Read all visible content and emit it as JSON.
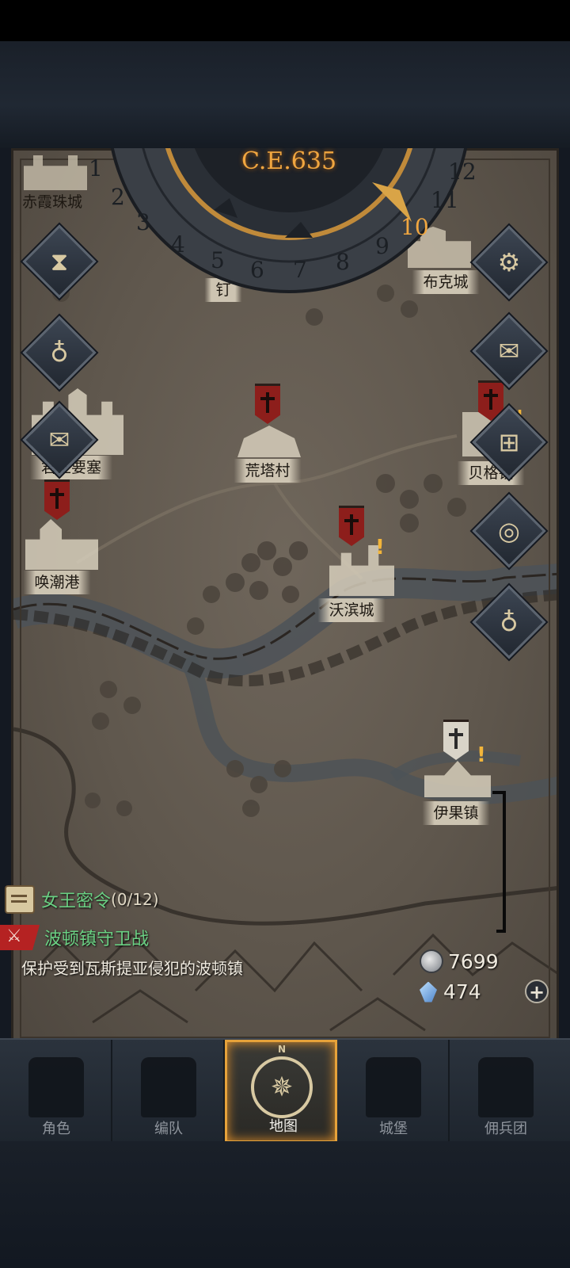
{
  "calendar": {
    "era": "C.E.635",
    "months": [
      "1",
      "2",
      "3",
      "4",
      "5",
      "6",
      "7",
      "8",
      "9",
      "10",
      "11",
      "12"
    ],
    "current_month": "10"
  },
  "cities": [
    {
      "name": "赤霞珠城"
    },
    {
      "name": "钉"
    },
    {
      "name": "布克城"
    },
    {
      "name": "荒塔村"
    },
    {
      "name": "君王要塞"
    },
    {
      "name": "贝格镇"
    },
    {
      "name": "唤潮港"
    },
    {
      "name": "沃滨城"
    },
    {
      "name": "伊果镇"
    }
  ],
  "side_buttons": {
    "left": [
      "hourglass-icon",
      "money-bag-icon",
      "scroll-icon"
    ],
    "right": [
      "gear-icon",
      "mail-icon",
      "window-icon",
      "coin-icon",
      "gold-bag-icon"
    ]
  },
  "quest": {
    "title": "女王密令",
    "progress": "(0/12)",
    "subtitle": "波顿镇守卫战",
    "description": "保护受到瓦斯提亚侵犯的波顿镇"
  },
  "resources": {
    "silver": "7699",
    "crystal": "474",
    "add_label": "+"
  },
  "nav": {
    "items": [
      {
        "label": "角色"
      },
      {
        "label": "编队"
      },
      {
        "label": "地图"
      },
      {
        "label": "城堡"
      },
      {
        "label": "佣兵团"
      }
    ],
    "active_index": 2,
    "compass_n": "N"
  },
  "colors": {
    "accent": "#e6a23a",
    "quest_green": "#6ad083",
    "banner_red": "#8d1e1b",
    "map_parchment": "#6f665b"
  }
}
